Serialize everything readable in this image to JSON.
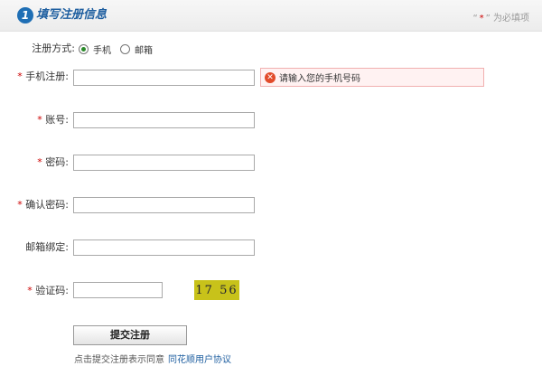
{
  "header": {
    "step_number": "1",
    "title": "填写注册信息",
    "required_note_prefix": "“",
    "required_note_star": "*",
    "required_note_suffix": "” 为必填项"
  },
  "form": {
    "register_method": {
      "label": "注册方式:",
      "options": [
        "手机",
        "邮箱"
      ],
      "selected": "手机"
    },
    "phone": {
      "label": "手机注册:",
      "value": "",
      "error": "请输入您的手机号码"
    },
    "account": {
      "label": "账号:",
      "value": ""
    },
    "password": {
      "label": "密码:",
      "value": ""
    },
    "confirm_password": {
      "label": "确认密码:",
      "value": ""
    },
    "email_bind": {
      "label": "邮箱绑定:",
      "value": ""
    },
    "captcha": {
      "label": "验证码:",
      "value": "",
      "image_text": "17 56"
    }
  },
  "actions": {
    "submit_label": "提交注册",
    "agree_text": "点击提交注册表示同意",
    "agreement_link": "同花顺用户协议"
  },
  "colors": {
    "accent": "#1f5fa0",
    "required": "#cc0000",
    "captcha_bg": "#c8c21a"
  }
}
